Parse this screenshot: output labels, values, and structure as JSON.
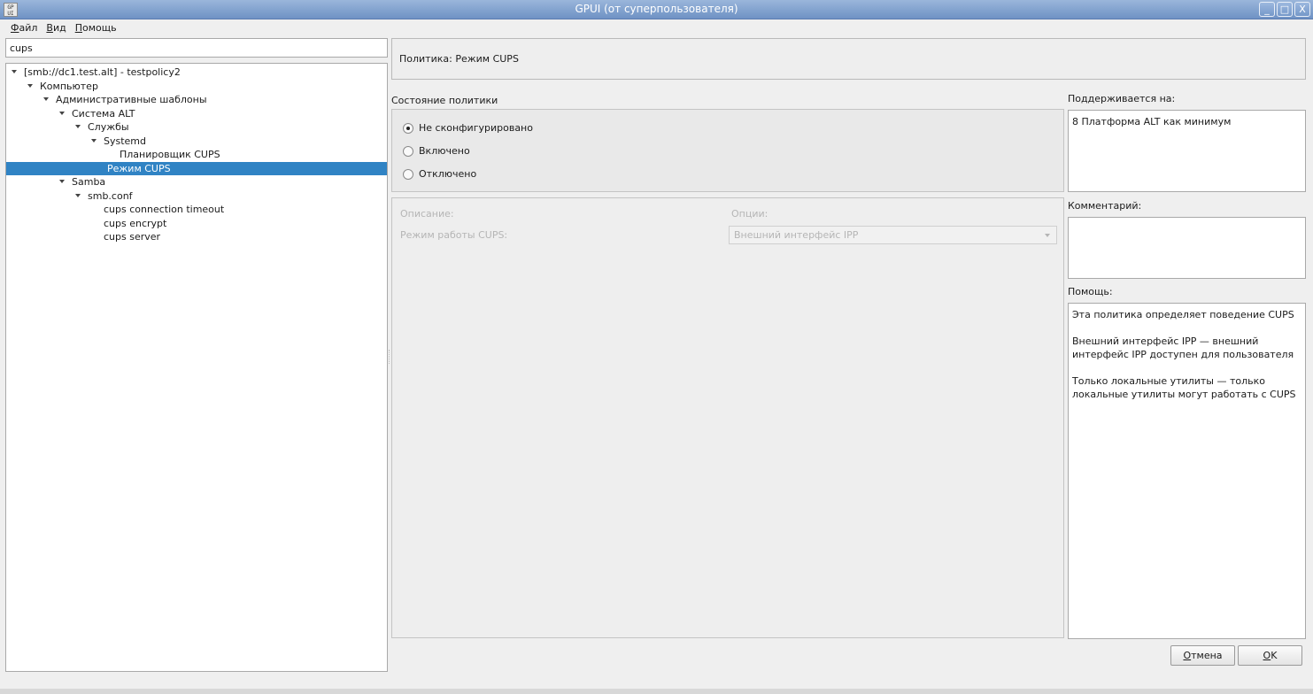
{
  "window": {
    "title": "GPUI (от суперпользователя)",
    "icon_text": "GP UI",
    "buttons": [
      "_",
      "□",
      "X"
    ]
  },
  "menu": {
    "items": [
      {
        "first": "Ф",
        "rest": "айл"
      },
      {
        "first": "В",
        "rest": "ид"
      },
      {
        "first": "П",
        "rest": "омощь"
      }
    ]
  },
  "search": {
    "value": "cups"
  },
  "tree": {
    "rows": [
      {
        "label": "[smb://dc1.test.alt] - testpolicy2",
        "depth": 0,
        "expanded": true
      },
      {
        "label": "Компьютер",
        "depth": 1,
        "expanded": true
      },
      {
        "label": "Административные шаблоны",
        "depth": 2,
        "expanded": true
      },
      {
        "label": "Система ALT",
        "depth": 3,
        "expanded": true
      },
      {
        "label": "Службы",
        "depth": 4,
        "expanded": true
      },
      {
        "label": "Systemd",
        "depth": 5,
        "expanded": true
      },
      {
        "label": "Планировщик CUPS",
        "depth": 6,
        "expanded": false
      },
      {
        "label": "Режим CUPS",
        "depth": 6,
        "expanded": false,
        "selected": true,
        "indent_level": 5
      },
      {
        "label": "Samba",
        "depth": 3,
        "expanded": true
      },
      {
        "label": "smb.conf",
        "depth": 4,
        "expanded": true
      },
      {
        "label": "cups connection timeout",
        "depth": 5,
        "expanded": false
      },
      {
        "label": "cups encrypt",
        "depth": 5,
        "expanded": false
      },
      {
        "label": "cups server",
        "depth": 5,
        "expanded": false
      }
    ]
  },
  "policy": {
    "title": "Политика: Режим CUPS"
  },
  "state": {
    "label": "Состояние политики",
    "options": [
      {
        "label": "Не сконфигурировано",
        "checked": true
      },
      {
        "label": "Включено",
        "checked": false
      },
      {
        "label": "Отключено",
        "checked": false
      }
    ]
  },
  "options_panel": {
    "description_label": "Описание:",
    "options_label": "Опции:",
    "row_label": "Режим работы CUPS:",
    "combo_value": "Внешний интерфейс IPP"
  },
  "supported": {
    "label": "Поддерживается на:",
    "value": "8 Платформа ALT как минимум"
  },
  "comment": {
    "label": "Комментарий:",
    "value": ""
  },
  "help": {
    "label": "Помощь:",
    "paragraphs": [
      "Эта политика определяет поведение CUPS",
      "Внешний интерфейс IPP — внешний\nинтерфейс IPP доступен для пользователя",
      "Только локальные утилиты — только\nлокальные утилиты могут работать с CUPS"
    ]
  },
  "buttons": {
    "cancel": {
      "first": "О",
      "rest": "тмена"
    },
    "ok": {
      "first": "O",
      "rest": "K"
    }
  }
}
